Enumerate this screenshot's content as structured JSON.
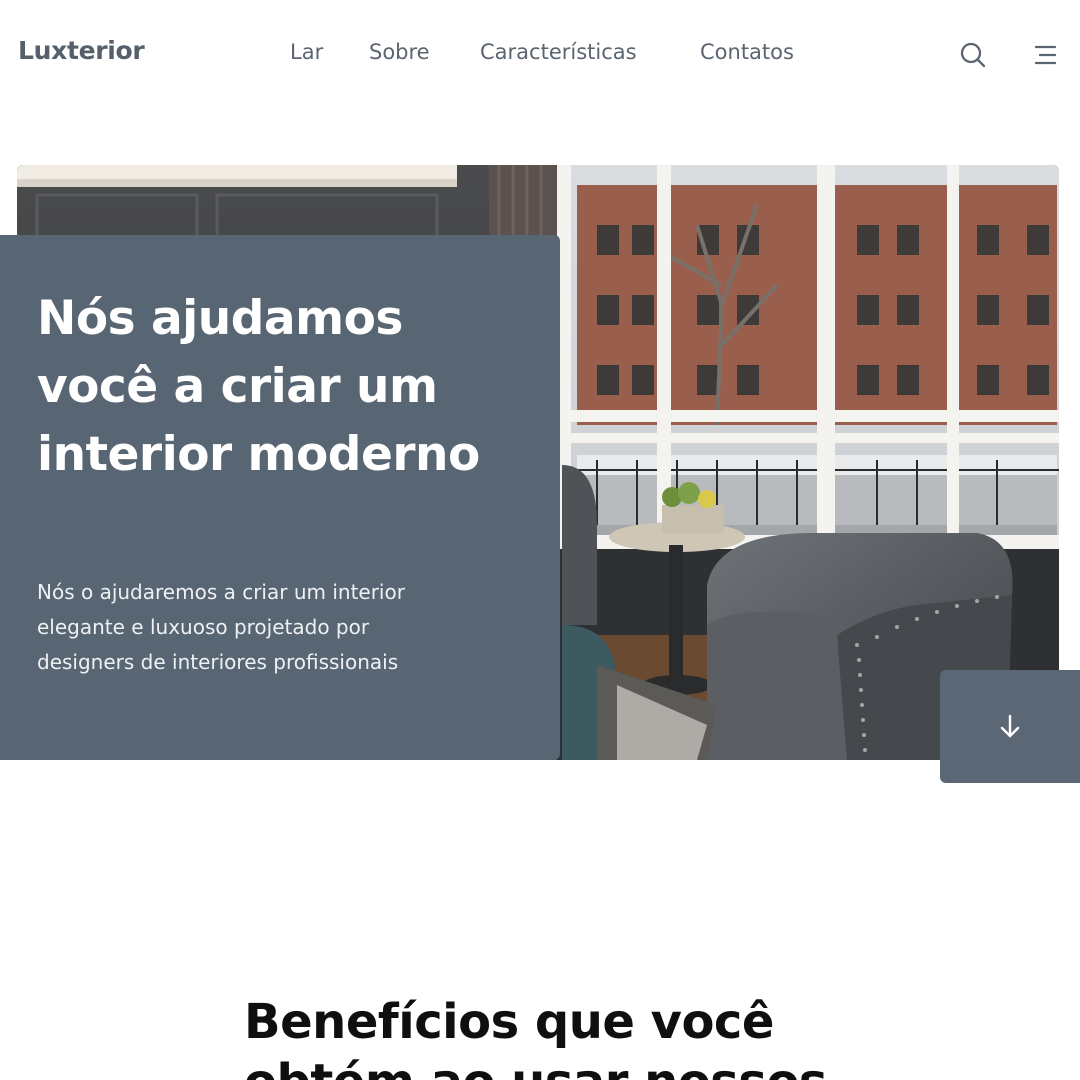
{
  "header": {
    "logo": "Luxterior",
    "nav": [
      "Lar",
      "Sobre",
      "Características",
      "Contatos"
    ],
    "icons": {
      "search": "search-icon",
      "menu": "menu-icon"
    }
  },
  "hero": {
    "title": "Nós ajudamos você a criar um interior moderno",
    "description": "Nós o ajudaremos a criar um interior elegante e luxuoso projetado por designers de interiores profissionais",
    "scroll_icon": "arrow-down-icon"
  },
  "section": {
    "title": "Benefícios que você obtém ao usar nossos"
  },
  "colors": {
    "card": "#586572",
    "button": "#5b6774",
    "text_dark": "#0f0f10",
    "nav": "#5b6570"
  }
}
